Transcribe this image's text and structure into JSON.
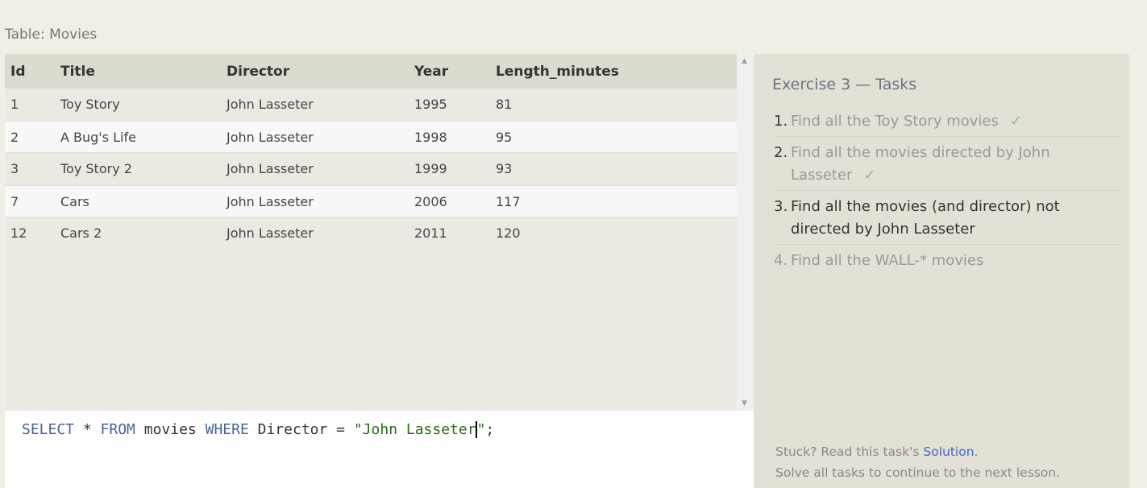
{
  "table_label": "Table: Movies",
  "table": {
    "columns": [
      "Id",
      "Title",
      "Director",
      "Year",
      "Length_minutes"
    ],
    "rows": [
      [
        "1",
        "Toy Story",
        "John Lasseter",
        "1995",
        "81"
      ],
      [
        "2",
        "A Bug's Life",
        "John Lasseter",
        "1998",
        "95"
      ],
      [
        "3",
        "Toy Story 2",
        "John Lasseter",
        "1999",
        "93"
      ],
      [
        "7",
        "Cars",
        "John Lasseter",
        "2006",
        "117"
      ],
      [
        "12",
        "Cars 2",
        "John Lasseter",
        "2011",
        "120"
      ]
    ]
  },
  "editor": {
    "kw1": "SELECT",
    "star": " * ",
    "kw2": "FROM",
    "t1": " movies ",
    "kw3": "WHERE",
    "t2": " Director = ",
    "str": "\"John Lasseter",
    "str_end": "\"",
    ";": ";"
  },
  "panel": {
    "title": "Exercise 3 — Tasks",
    "tasks": [
      {
        "num": "1.",
        "text": "Find all the Toy Story movies",
        "check": "✓",
        "status": "done"
      },
      {
        "num": "2.",
        "text": "Find all the movies directed by John Lasseter",
        "check": "✓",
        "status": "done"
      },
      {
        "num": "3.",
        "text": "Find all the movies (and director) not directed by John Lasseter",
        "status": "current"
      },
      {
        "num": "4.",
        "text": "Find all the WALL-* movies",
        "status": "todo"
      }
    ],
    "stuck_prefix": "Stuck? Read this task's ",
    "solution_link": "Solution",
    "stuck_suffix": ".",
    "continue_text": "Solve all tasks to continue to the next lesson."
  },
  "colors": {
    "accent_link": "#3f66c8",
    "check": "#7fbf8a",
    "keyword": "#4a6596",
    "string": "#2a6b1c"
  }
}
